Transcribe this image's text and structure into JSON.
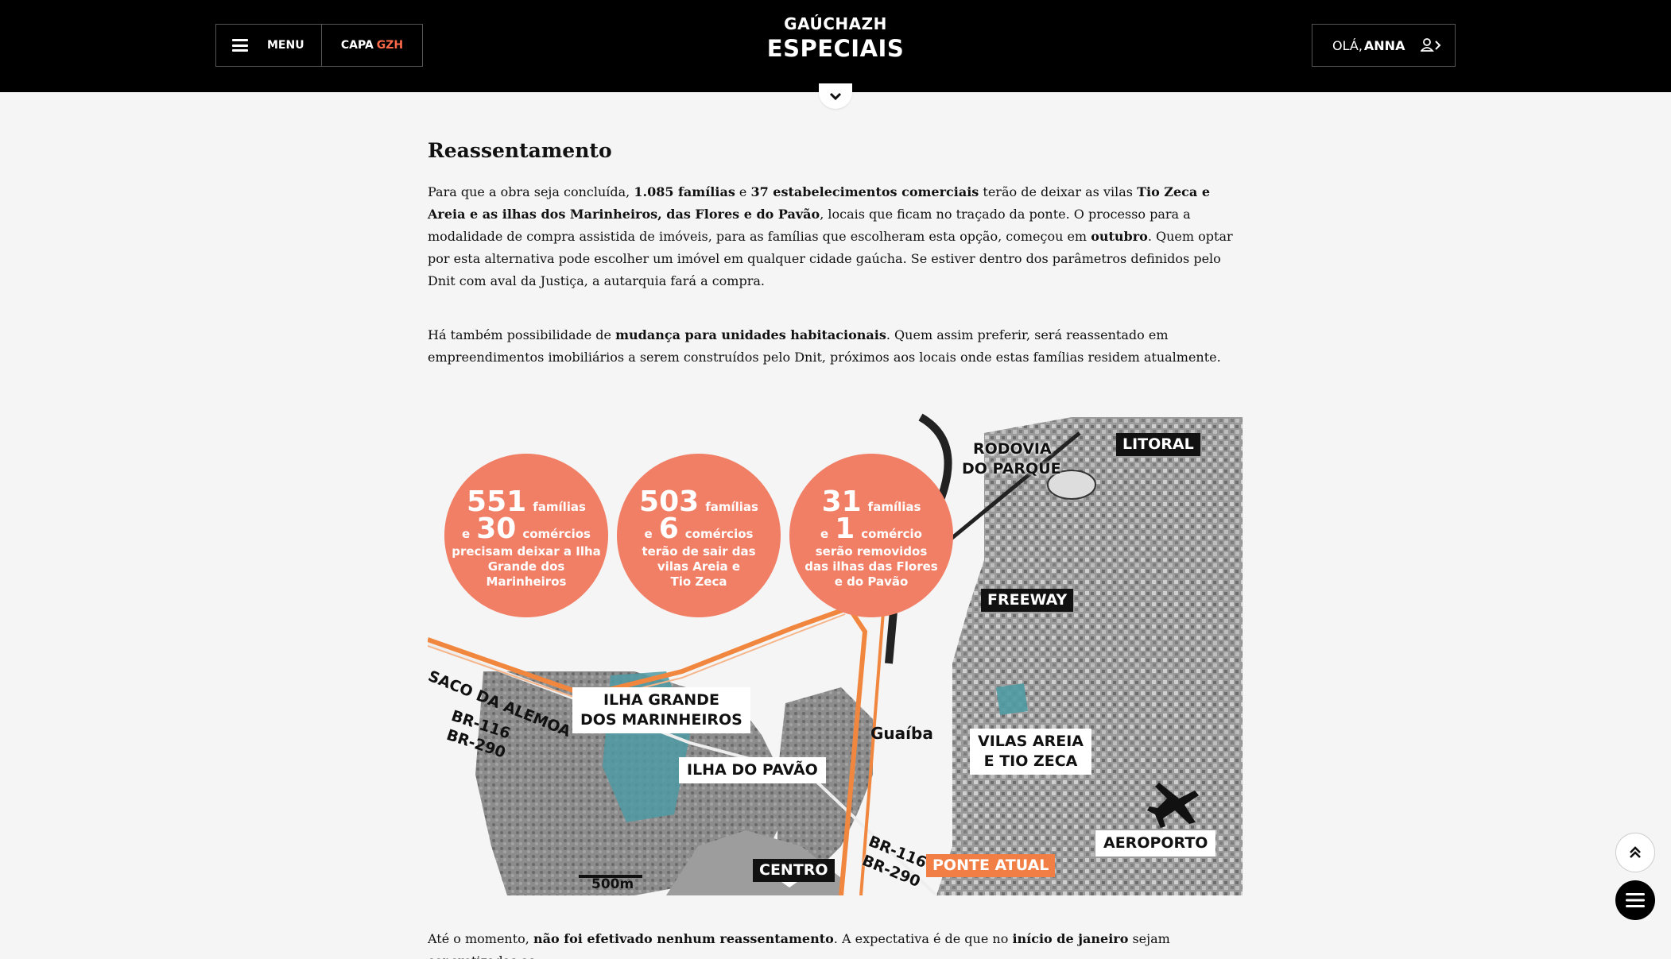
{
  "header": {
    "menu_label": "MENU",
    "capa_label": "CAPA",
    "capa_brand": "GZH",
    "logo_top": "GAÚCHAZH",
    "logo_main": "ESPECIAIS",
    "user_greeting": "OLÁ,",
    "user_name": "ANNA"
  },
  "article": {
    "heading": "Reassentamento",
    "p1": [
      {
        "t": "Para que a obra seja concluída, "
      },
      {
        "t": "1.085 famílias",
        "b": true
      },
      {
        "t": " e "
      },
      {
        "t": "37 estabelecimentos comerciais",
        "b": true
      },
      {
        "t": " terão de deixar as vilas "
      },
      {
        "t": "Tio Zeca e Areia e as ilhas dos Marinheiros, das Flores e do Pavão",
        "b": true
      },
      {
        "t": ", locais que ficam no traçado da ponte. O processo para a modalidade de compra assistida de imóveis, para as famílias que escolheram esta opção, começou em "
      },
      {
        "t": "outubro",
        "b": true
      },
      {
        "t": ". Quem optar por esta alternativa pode escolher um imóvel em qualquer cidade gaúcha. Se estiver dentro dos parâmetros definidos pelo Dnit com aval da Justiça, a autarquia fará a compra."
      }
    ],
    "p2": [
      {
        "t": "Há também possibilidade de "
      },
      {
        "t": "mudança para unidades habitacionais",
        "b": true
      },
      {
        "t": ". Quem assim preferir, será reassentado em empreendimentos imobiliários a serem construídos pelo Dnit, próximos aos locais onde estas famílias residem atualmente."
      }
    ],
    "p3": [
      {
        "t": "Até o momento, "
      },
      {
        "t": "não foi efetivado nenhum reassentamento",
        "b": true
      },
      {
        "t": ". A expectativa é de que no "
      },
      {
        "t": "início de janeiro",
        "b": true
      },
      {
        "t": " sejam concretizadas as"
      }
    ]
  },
  "infographic": {
    "circles": [
      {
        "n1": "551",
        "w1": "famílias",
        "e": "e",
        "n2": "30",
        "w2": "comércios",
        "desc": [
          "precisam deixar a Ilha",
          "Grande dos",
          "Marinheiros"
        ]
      },
      {
        "n1": "503",
        "w1": "famílias",
        "e": "e",
        "n2": "6",
        "w2": "comércios",
        "desc": [
          "terão de sair das",
          "vilas Areia e",
          "Tio Zeca"
        ]
      },
      {
        "n1": "31",
        "w1": "famílias",
        "e": "e",
        "n2": "1",
        "w2": "comércio",
        "desc": [
          "serão removidos",
          "das ilhas das Flores",
          "e do Pavão"
        ]
      }
    ],
    "labels": {
      "rodovia": [
        "RODOVIA",
        "DO PARQUE"
      ],
      "litoral": "LITORAL",
      "freeway": "FREEWAY",
      "saco": "SACO DA ALEMOA",
      "br116_left": "BR-116",
      "br290_left": "BR-290",
      "ilha_grande": [
        "ILHA GRANDE",
        "DOS MARINHEIROS"
      ],
      "guaiba": "Guaíba",
      "ilha_pavao": "ILHA DO PAVÃO",
      "vilas": [
        "VILAS AREIA",
        "E TIO ZECA"
      ],
      "aeroporto": "AEROPORTO",
      "br116_right": "BR-116",
      "br290_right": "BR-290",
      "ponte": "PONTE ATUAL",
      "centro": "CENTRO",
      "scale": "500m"
    },
    "colors": {
      "circle": "#f17f66",
      "route": "#f1873f",
      "island": "#4f9aa3"
    }
  }
}
